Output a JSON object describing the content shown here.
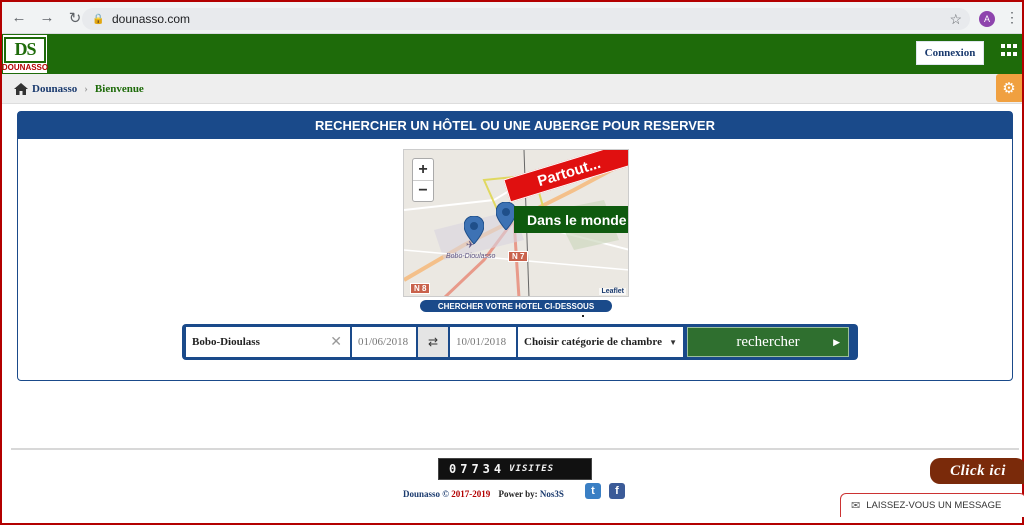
{
  "browser": {
    "url": "dounasso.com",
    "profile_initial": "A"
  },
  "header": {
    "logo_mark": "DS",
    "logo_text": "DOUNASSO",
    "login_label": "Connexion"
  },
  "breadcrumb": {
    "home": "Dounasso",
    "current": "Bienvenue"
  },
  "search_panel": {
    "title": "RECHERCHER UN HÔTEL OU UNE AUBERGE POUR RESERVER",
    "map": {
      "city_label": "Bobo-Dioulasso",
      "road_labels": [
        "N 7",
        "N 8"
      ],
      "banner_top": "Partout...",
      "banner_bottom": "Dans le monde",
      "attribution": "Leaflet"
    },
    "ribbon": "CHERCHER VOTRE HOTEL CI-DESSOUS",
    "city_value": "Bobo-Dioulass",
    "date_from": "01/06/2018",
    "date_to": "10/01/2018",
    "category_value": "Choisir catégorie de chambre",
    "submit_label": "rechercher"
  },
  "footer": {
    "counter_digits": "07734",
    "counter_label": "VISITES",
    "brand": "Dounasso ©",
    "years": "2017-2019",
    "powered_by": "Power by:",
    "powered_name": "Nos3S"
  },
  "widgets": {
    "click_here": "Click ici",
    "message_label": "LAISSEZ-VOUS UN MESSAGE"
  },
  "colors": {
    "header_green": "#1e6b0a",
    "panel_blue": "#1a4a8a",
    "submit_green": "#2f6f2f",
    "banner_red": "#e01010"
  }
}
